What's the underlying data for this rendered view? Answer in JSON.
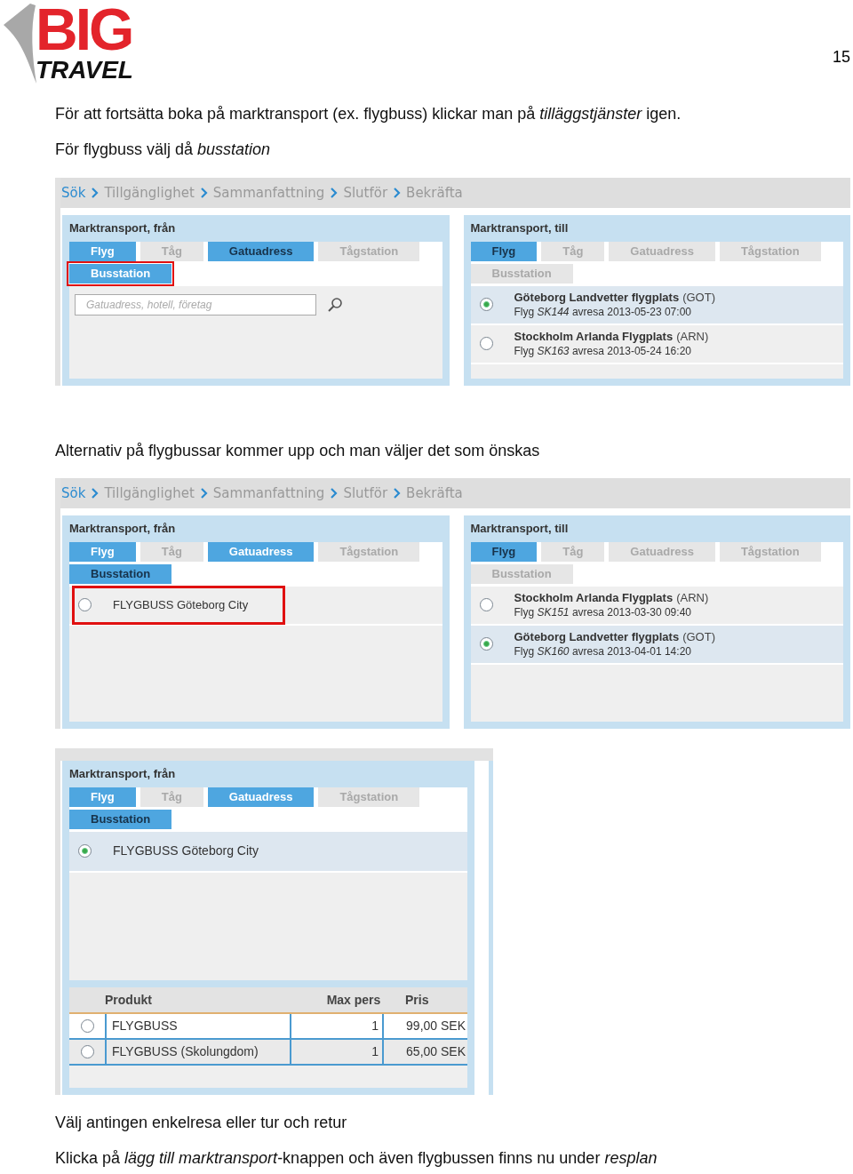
{
  "header": {
    "logo_top": "BIG",
    "logo_bottom": "TRAVEL",
    "page_number": "15"
  },
  "blocks": [
    {
      "kind": "text",
      "text": "För att fortsätta boka på marktransport (ex. flygbuss) klickar man på *tilläggstjänster* igen."
    },
    {
      "kind": "text",
      "text": "För flygbuss välj då *busstation*"
    },
    {
      "kind": "screenshot",
      "breadcrumb": [
        {
          "label": "Sök",
          "current": true
        },
        {
          "label": "Tillgänglighet",
          "current": false
        },
        {
          "label": "Sammanfattning",
          "current": false
        },
        {
          "label": "Slutför",
          "current": false
        },
        {
          "label": "Bekräfta",
          "current": false
        }
      ],
      "panels": [
        {
          "title": "Marktransport, från",
          "tabs": [
            {
              "label": "Flyg",
              "selected": false,
              "disabled": false,
              "highlighted": false
            },
            {
              "label": "Tåg",
              "selected": false,
              "disabled": true,
              "highlighted": false
            },
            {
              "label": "Gatuadress",
              "selected": true,
              "disabled": false,
              "highlighted": false
            },
            {
              "label": "Tågstation",
              "selected": false,
              "disabled": true,
              "highlighted": false
            },
            {
              "label": "Busstation",
              "selected": false,
              "disabled": false,
              "highlighted": true
            }
          ],
          "search": {
            "placeholder": "Gatuadress, hotell, företag"
          }
        },
        {
          "title": "Marktransport, till",
          "tabs": [
            {
              "label": "Flyg",
              "selected": true,
              "disabled": false,
              "highlighted": false
            },
            {
              "label": "Tåg",
              "selected": false,
              "disabled": true,
              "highlighted": false
            },
            {
              "label": "Gatuadress",
              "selected": false,
              "disabled": true,
              "highlighted": false
            },
            {
              "label": "Tågstation",
              "selected": false,
              "disabled": true,
              "highlighted": false
            },
            {
              "label": "Busstation",
              "selected": false,
              "disabled": true,
              "highlighted": false
            }
          ],
          "options": [
            {
              "kind": "airport",
              "name": "Göteborg Landvetter flygplats",
              "code": "(GOT)",
              "detail": "Flyg *SK144* avresa 2013-05-23 07:00",
              "selected": true,
              "highlighted": false
            },
            {
              "kind": "airport",
              "name": "Stockholm Arlanda Flygplats",
              "code": "(ARN)",
              "detail": "Flyg *SK163* avresa 2013-05-24 16:20",
              "selected": false,
              "highlighted": false
            }
          ]
        }
      ]
    },
    {
      "kind": "text",
      "text": "Alternativ på flygbussar kommer upp och man väljer det som önskas"
    },
    {
      "kind": "screenshot",
      "breadcrumb": [
        {
          "label": "Sök",
          "current": true
        },
        {
          "label": "Tillgänglighet",
          "current": false
        },
        {
          "label": "Sammanfattning",
          "current": false
        },
        {
          "label": "Slutför",
          "current": false
        },
        {
          "label": "Bekräfta",
          "current": false
        }
      ],
      "panels": [
        {
          "title": "Marktransport, från",
          "tabs": [
            {
              "label": "Flyg",
              "selected": false,
              "disabled": false,
              "highlighted": false
            },
            {
              "label": "Tåg",
              "selected": false,
              "disabled": true,
              "highlighted": false
            },
            {
              "label": "Gatuadress",
              "selected": false,
              "disabled": false,
              "highlighted": false
            },
            {
              "label": "Tågstation",
              "selected": false,
              "disabled": true,
              "highlighted": false
            },
            {
              "label": "Busstation",
              "selected": true,
              "disabled": false,
              "highlighted": false
            }
          ],
          "options": [
            {
              "kind": "stop",
              "name": "FLYGBUSS Göteborg City",
              "selected": false,
              "highlighted": true
            }
          ]
        },
        {
          "title": "Marktransport, till",
          "tabs": [
            {
              "label": "Flyg",
              "selected": true,
              "disabled": false,
              "highlighted": false
            },
            {
              "label": "Tåg",
              "selected": false,
              "disabled": true,
              "highlighted": false
            },
            {
              "label": "Gatuadress",
              "selected": false,
              "disabled": true,
              "highlighted": false
            },
            {
              "label": "Tågstation",
              "selected": false,
              "disabled": true,
              "highlighted": false
            },
            {
              "label": "Busstation",
              "selected": false,
              "disabled": true,
              "highlighted": false
            }
          ],
          "options": [
            {
              "kind": "airport",
              "name": "Stockholm Arlanda Flygplats",
              "code": "(ARN)",
              "detail": "Flyg *SK151* avresa 2013-03-30 09:40",
              "selected": false,
              "highlighted": false
            },
            {
              "kind": "airport",
              "name": "Göteborg Landvetter flygplats",
              "code": "(GOT)",
              "detail": "Flyg *SK160* avresa 2013-04-01 14:20",
              "selected": true,
              "highlighted": false
            }
          ]
        }
      ]
    },
    {
      "kind": "screenshot",
      "panels": [
        {
          "title": "Marktransport, från",
          "tabs": [
            {
              "label": "Flyg",
              "selected": false,
              "disabled": false,
              "highlighted": false
            },
            {
              "label": "Tåg",
              "selected": false,
              "disabled": true,
              "highlighted": false
            },
            {
              "label": "Gatuadress",
              "selected": false,
              "disabled": false,
              "highlighted": false
            },
            {
              "label": "Tågstation",
              "selected": false,
              "disabled": true,
              "highlighted": false
            },
            {
              "label": "Busstation",
              "selected": true,
              "disabled": false,
              "highlighted": false
            }
          ],
          "options": [
            {
              "kind": "stop",
              "name": "FLYGBUSS Göteborg City",
              "selected": true,
              "highlighted": false
            }
          ],
          "products": {
            "columns": [
              "Produkt",
              "Max pers",
              "Pris"
            ],
            "rows": [
              {
                "selected": false,
                "cells": [
                  "FLYGBUSS",
                  "1",
                  "99,00 SEK"
                ]
              },
              {
                "selected": false,
                "cells": [
                  "FLYGBUSS (Skolungdom)",
                  "1",
                  "65,00 SEK"
                ]
              }
            ]
          }
        }
      ]
    },
    {
      "kind": "text",
      "text": "Välj antingen enkelresa eller tur och retur"
    },
    {
      "kind": "text",
      "text": "Klicka på *lägg till marktransport*-knappen och även flygbussen finns nu under *resplan*"
    }
  ]
}
